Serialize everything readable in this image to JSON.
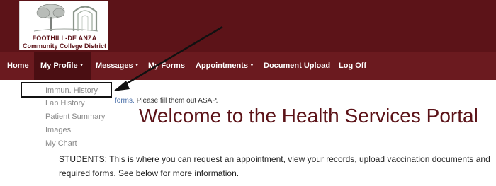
{
  "logo": {
    "line1": "FOOTHILL-DE ANZA",
    "line2": "Community College District"
  },
  "nav": {
    "home": "Home",
    "my_profile": "My Profile",
    "messages": "Messages",
    "my_forms": "My Forms",
    "appointments": "Appointments",
    "document_upload": "Document Upload",
    "log_off": "Log Off"
  },
  "dropdown": {
    "items": [
      "Immun. History",
      "Lab History",
      "Patient Summary",
      "Images",
      "My Chart"
    ]
  },
  "notice": {
    "link_text": "forms.",
    "text": "Please fill them out ASAP."
  },
  "main": {
    "title": "Welcome to the Health Services Portal",
    "body_line1": "STUDENTS: This is where you can request an appointment, view your records, upload vaccination documents and",
    "body_line2": "required forms. See below for more information."
  },
  "colors": {
    "brand": "#5c1318",
    "nav_bg": "#6b1a1f",
    "nav_active": "#4a0e12",
    "link": "#4a6fa8"
  }
}
